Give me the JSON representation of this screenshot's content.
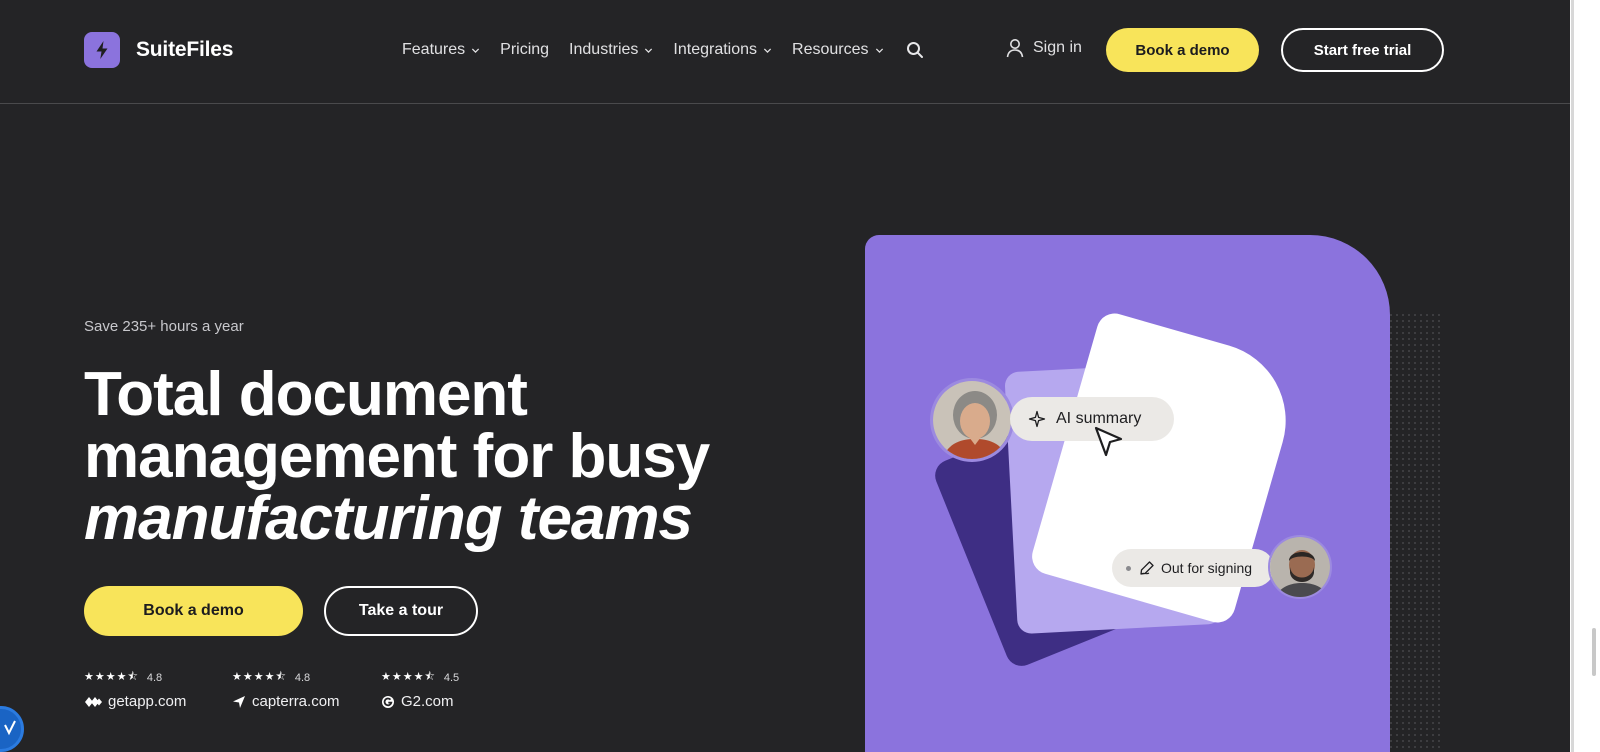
{
  "brand": {
    "name": "SuiteFiles",
    "accent": "#8b73dd",
    "cta": "#f8e45a"
  },
  "nav": {
    "items": [
      {
        "label": "Features",
        "has_dropdown": true
      },
      {
        "label": "Pricing",
        "has_dropdown": false
      },
      {
        "label": "Industries",
        "has_dropdown": true
      },
      {
        "label": "Integrations",
        "has_dropdown": true
      },
      {
        "label": "Resources",
        "has_dropdown": true
      }
    ],
    "search_icon": "search-icon",
    "sign_in": "Sign in",
    "book_demo": "Book a demo",
    "start_trial": "Start free trial"
  },
  "hero": {
    "eyebrow": "Save 235+ hours a year",
    "headline_line1": "Total document",
    "headline_line2": "management for busy",
    "headline_italic": "manufacturing teams",
    "cta_primary": "Book a demo",
    "cta_secondary": "Take a tour"
  },
  "ratings": [
    {
      "score": "4.8",
      "stars": 4.5,
      "site": "getapp.com",
      "icon": "getapp-icon"
    },
    {
      "score": "4.8",
      "stars": 4.5,
      "site": "capterra.com",
      "icon": "capterra-icon"
    },
    {
      "score": "4.5",
      "stars": 4.5,
      "site": "G2.com",
      "icon": "g2-icon"
    }
  ],
  "illustration": {
    "ai_pill": "AI summary",
    "sign_pill": "Out for signing"
  }
}
